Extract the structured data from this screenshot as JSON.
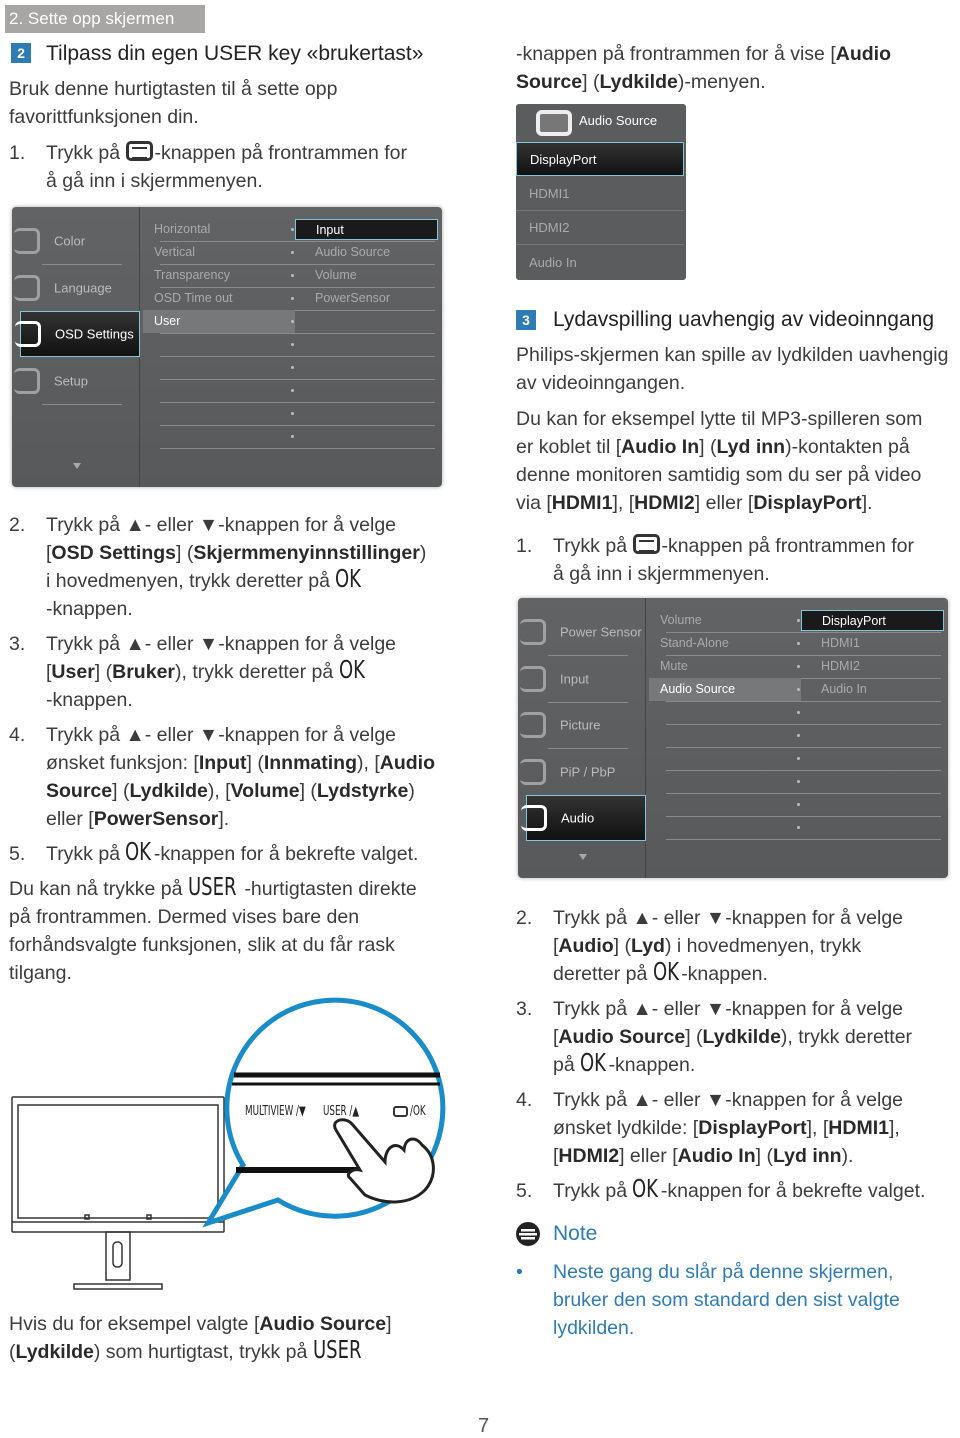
{
  "section_tab": "2. Sette opp skjermen",
  "heading2": {
    "number": "2",
    "title": "Tilpass din egen USER key «brukertast»"
  },
  "heading3": {
    "number": "3",
    "title": "Lydavspilling uavhengig av videoinngang"
  },
  "left": [
    {
      "lines": [
        [
          "Bruk denne hurtigtasten til å sette opp"
        ],
        [
          "favorittfunksjonen din."
        ]
      ]
    },
    {
      "num": "1.",
      "lines": [
        [
          "Trykk på ",
          {
            "icon": "menu-button-icon"
          },
          "-knappen på frontrammen for"
        ],
        [
          "å gå inn i skjermmenyen."
        ]
      ]
    },
    {
      "num": "2.",
      "lines": [
        [
          "Trykk på ▲- eller ▼-knappen for å velge"
        ],
        [
          "[",
          {
            "b": "OSD Settings"
          },
          "] (",
          {
            "b": "Skjermmenyinnstillinger"
          },
          ")"
        ],
        [
          "i hovedmenyen, trykk deretter på ",
          {
            "k": "OK"
          }
        ],
        [
          "-knappen."
        ]
      ]
    },
    {
      "num": "3.",
      "lines": [
        [
          "Trykk på ▲- eller ▼-knappen for å velge"
        ],
        [
          "[",
          {
            "b": "User"
          },
          "] (",
          {
            "b": "Bruker"
          },
          "), trykk deretter på ",
          {
            "k": "OK"
          }
        ],
        [
          "-knappen."
        ]
      ]
    },
    {
      "num": "4.",
      "lines": [
        [
          "Trykk på ▲- eller ▼-knappen for å velge"
        ],
        [
          "ønsket funksjon: [",
          {
            "b": "Input"
          },
          "] (",
          {
            "b": "Innmating"
          },
          "), [",
          {
            "b": "Audio"
          }
        ],
        [
          {
            "b": "Source"
          },
          "] (",
          {
            "b": "Lydkilde"
          },
          "), [",
          {
            "b": "Volume"
          },
          "] (",
          {
            "b": "Lydstyrke"
          },
          ")"
        ],
        [
          "eller [",
          {
            "b": "PowerSensor"
          },
          "]."
        ]
      ]
    },
    {
      "num": "5.",
      "lines": [
        [
          "Trykk på ",
          {
            "k": "OK"
          },
          "-knappen for å bekrefte valget."
        ]
      ]
    },
    {
      "lines": [
        [
          "Du kan nå trykke på ",
          {
            "k": "USER"
          },
          "-hurtigtasten direkte"
        ],
        [
          "på frontrammen. Dermed vises bare den"
        ],
        [
          "forhåndsvalgte funksjonen, slik at du får rask"
        ],
        [
          "tilgang."
        ]
      ]
    },
    {
      "lines": [
        [
          "Hvis du for eksempel valgte [",
          {
            "b": "Audio Source"
          },
          "]"
        ],
        [
          "(",
          {
            "b": "Lydkilde"
          },
          ") som hurtigtast, trykk på ",
          {
            "k": "USER"
          }
        ]
      ]
    }
  ],
  "right": [
    {
      "lines": [
        [
          "-knappen på frontrammen for å vise [",
          {
            "b": "Audio"
          }
        ],
        [
          {
            "b": "Source"
          },
          "] (",
          {
            "b": "Lydkilde"
          },
          ")-menyen."
        ]
      ]
    },
    {
      "lines": [
        [
          "Philips-skjermen kan spille av lydkilden uavhengig"
        ],
        [
          "av videoinngangen."
        ]
      ]
    },
    {
      "lines": [
        [
          "Du kan for eksempel lytte til MP3-spilleren som"
        ],
        [
          "er koblet til [",
          {
            "b": "Audio In"
          },
          "] (",
          {
            "b": "Lyd inn"
          },
          ")-kontakten på"
        ],
        [
          "denne monitoren samtidig som du ser på video"
        ],
        [
          "via [",
          {
            "b": "HDMI1"
          },
          "], [",
          {
            "b": "HDMI2"
          },
          "] eller [",
          {
            "b": "DisplayPort"
          },
          "]."
        ]
      ]
    },
    {
      "num": "1.",
      "lines": [
        [
          "Trykk på ",
          {
            "icon": "menu-button-icon"
          },
          "-knappen på frontrammen for"
        ],
        [
          "å gå inn i skjermmenyen."
        ]
      ]
    },
    {
      "num": "2.",
      "lines": [
        [
          "Trykk på ▲- eller ▼-knappen for å velge"
        ],
        [
          "[",
          {
            "b": "Audio"
          },
          "] (",
          {
            "b": "Lyd"
          },
          ") i hovedmenyen, trykk"
        ],
        [
          "deretter på ",
          {
            "k": "OK"
          },
          "-knappen."
        ]
      ]
    },
    {
      "num": "3.",
      "lines": [
        [
          "Trykk på ▲- eller ▼-knappen for å velge"
        ],
        [
          "[",
          {
            "b": "Audio Source"
          },
          "] (",
          {
            "b": "Lydkilde"
          },
          "), trykk deretter"
        ],
        [
          "på ",
          {
            "k": "OK"
          },
          "-knappen."
        ]
      ]
    },
    {
      "num": "4.",
      "lines": [
        [
          "Trykk på ▲- eller ▼-knappen for å velge"
        ],
        [
          "ønsket lydkilde: [",
          {
            "b": "DisplayPort"
          },
          "], [",
          {
            "b": "HDMI1"
          },
          "],"
        ],
        [
          "[",
          {
            "b": "HDMI2"
          },
          "] eller [",
          {
            "b": "Audio In"
          },
          "] (",
          {
            "b": "Lyd inn"
          },
          ")."
        ]
      ]
    },
    {
      "num": "5.",
      "lines": [
        [
          "Trykk på ",
          {
            "k": "OK"
          },
          "-knappen for å bekrefte valget."
        ]
      ]
    },
    {
      "num": "•",
      "lines": [
        [
          "Neste gang du slår på denne skjermen,"
        ],
        [
          "bruker den som standard den sist valgte"
        ],
        [
          "lydkilden."
        ]
      ]
    }
  ],
  "note": {
    "title": "Note",
    "icon": "note-icon",
    "color": "#2f7bb4"
  },
  "osd1": {
    "left_items": [
      {
        "label": "Color",
        "icon": "color-icon"
      },
      {
        "label": "Language",
        "icon": "language-icon"
      },
      {
        "label": "OSD Settings",
        "icon": "osd-settings-icon",
        "selected": true
      },
      {
        "label": "Setup",
        "icon": "setup-gear-icon"
      }
    ],
    "mid_items": [
      {
        "label": "Horizontal"
      },
      {
        "label": "Vertical"
      },
      {
        "label": "Transparency"
      },
      {
        "label": "OSD Time out"
      },
      {
        "label": "User",
        "highlighted": true
      }
    ],
    "right_items": [
      {
        "label": "Input",
        "selected": true
      },
      {
        "label": "Audio Source"
      },
      {
        "label": "Volume"
      },
      {
        "label": "PowerSensor"
      }
    ]
  },
  "osd2": {
    "left_items": [
      {
        "label": "Power Sensor",
        "icon": "power-sensor-icon"
      },
      {
        "label": "Input",
        "icon": "input-icon"
      },
      {
        "label": "Picture",
        "icon": "picture-icon"
      },
      {
        "label": "PiP / PbP",
        "icon": "pip-icon"
      },
      {
        "label": "Audio",
        "icon": "speaker-icon",
        "selected": true
      }
    ],
    "mid_items": [
      {
        "label": "Volume"
      },
      {
        "label": "Stand-Alone"
      },
      {
        "label": "Mute"
      },
      {
        "label": "Audio Source",
        "highlighted": true
      }
    ],
    "right_items": [
      {
        "label": "DisplayPort",
        "selected": true
      },
      {
        "label": "HDMI1"
      },
      {
        "label": "HDMI2"
      },
      {
        "label": "Audio In"
      }
    ]
  },
  "audio_popup": {
    "title": "Audio Source",
    "items": [
      {
        "label": "DisplayPort",
        "selected": true
      },
      {
        "label": "HDMI1"
      },
      {
        "label": "HDMI2"
      },
      {
        "label": "Audio In"
      }
    ]
  },
  "illustration": {
    "multiview": "MULTIVIEW /▼",
    "user": "USER /▲",
    "ok": "/OK",
    "accent": "#1a8cc8"
  },
  "page_number": "7"
}
